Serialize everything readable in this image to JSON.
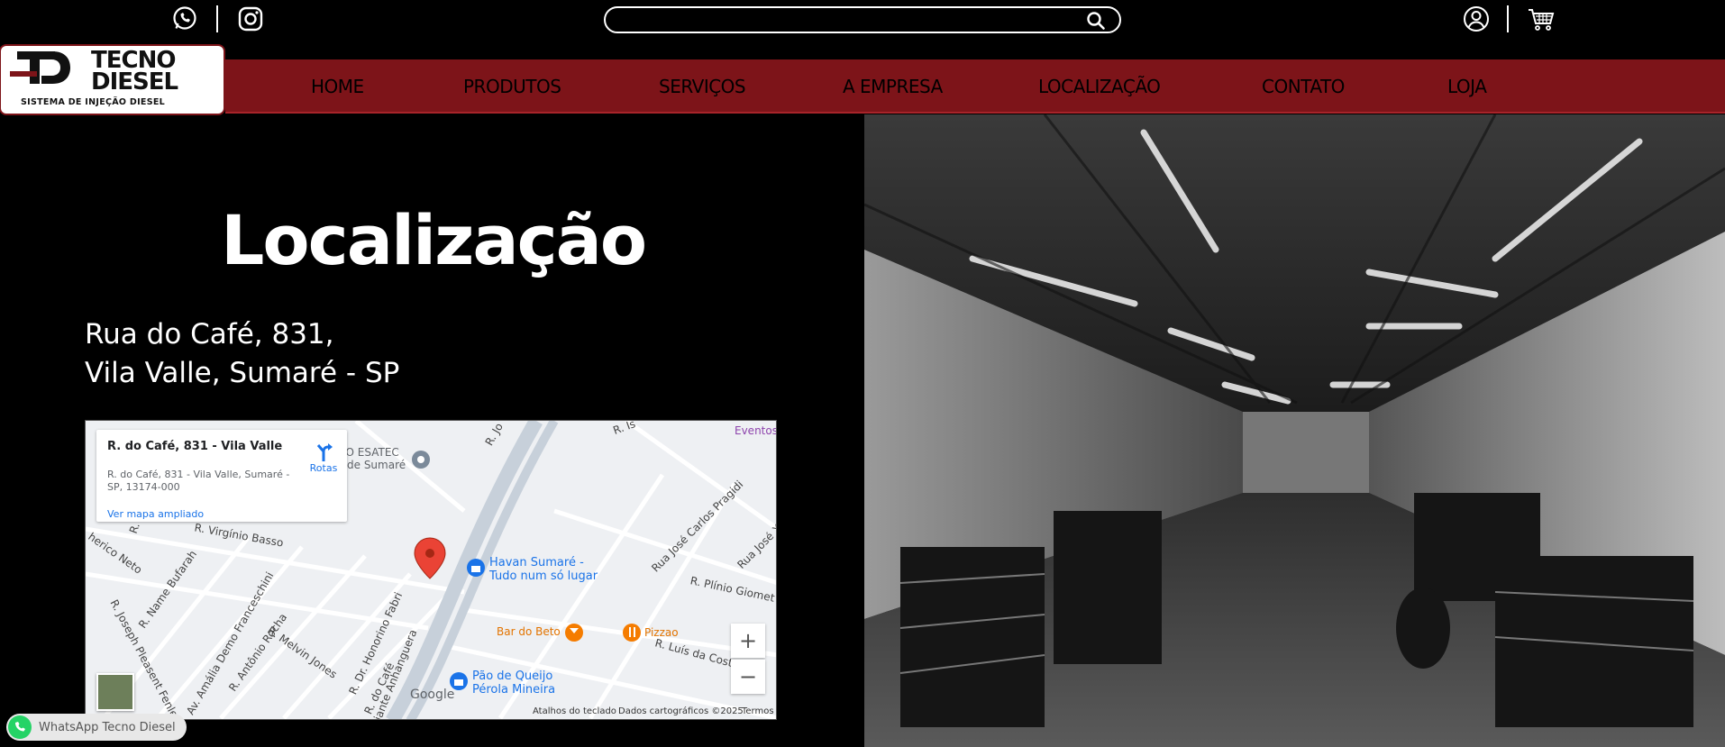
{
  "topbar": {
    "search_placeholder": "",
    "icons": {
      "whatsapp": "whatsapp-icon",
      "instagram": "instagram-icon",
      "search": "search-icon",
      "account": "account-icon",
      "cart": "cart-icon"
    }
  },
  "logo": {
    "name_line1": "TECNO",
    "name_line2": "DIESEL",
    "tagline": "SISTEMA DE INJEÇÃO DIESEL",
    "mark": "TD"
  },
  "nav": {
    "items": [
      {
        "label": "HOME"
      },
      {
        "label": "PRODUTOS"
      },
      {
        "label": "SERVIÇOS"
      },
      {
        "label": "A EMPRESA"
      },
      {
        "label": "LOCALIZAÇÃO"
      },
      {
        "label": "CONTATO"
      },
      {
        "label": "LOJA"
      }
    ]
  },
  "hero": {
    "title": "Localização",
    "address_line1": "Rua do Café, 831,",
    "address_line2": "Vila Valle, Sumaré - SP"
  },
  "map": {
    "card_title": "R. do Café, 831 - Vila Valle",
    "card_address": "R. do Café, 831 - Vila Valle, Sumaré - SP, 13174-000",
    "card_link": "Ver mapa ampliado",
    "directions_label": "Rotas",
    "zoom_in": "+",
    "zoom_out": "−",
    "google_label": "Google",
    "footer_shortcuts": "Atalhos do teclado",
    "footer_data": "Dados cartográficos ©2025",
    "footer_terms": "Termos",
    "places": [
      {
        "text": "Havan Sumaré -",
        "kind": "shop"
      },
      {
        "text": "Tudo num só lugar",
        "kind": "shop"
      },
      {
        "text": "Bar do Beto",
        "kind": "food"
      },
      {
        "text": "Pizzao",
        "kind": "food"
      },
      {
        "text": "Pão de Queijo",
        "kind": "shop"
      },
      {
        "text": "Pérola Mineira",
        "kind": "shop"
      },
      {
        "text": "IO ESATEC",
        "kind": "poi"
      },
      {
        "text": "de Sumaré",
        "kind": "poi"
      },
      {
        "text": "Eventos",
        "kind": "event"
      }
    ],
    "streets": [
      "R. Virgínio Basso",
      "R. Name Bufarah",
      "R. Joseph Pleasent Fenley",
      "Av. Amália Demo Franceschini",
      "R. Antônio Rocha",
      "R. Melvin Jones",
      "R. Dr. Honorino Fabri",
      "R. do Café",
      "Rua José Carlos Pragidi",
      "Rua José Xa",
      "R. Plínio Giomet",
      "R. Luís da Costa Pint",
      "R. Cas",
      "herico Neto",
      "iante Anhanguera",
      "R. Jo",
      "R. Is"
    ]
  },
  "whatsapp_badge": {
    "label": "WhatsApp Tecno Diesel"
  },
  "colors": {
    "nav_bg": "#7d1419",
    "background": "#000000",
    "map_link": "#1a73e8",
    "pin": "#ea4335"
  }
}
